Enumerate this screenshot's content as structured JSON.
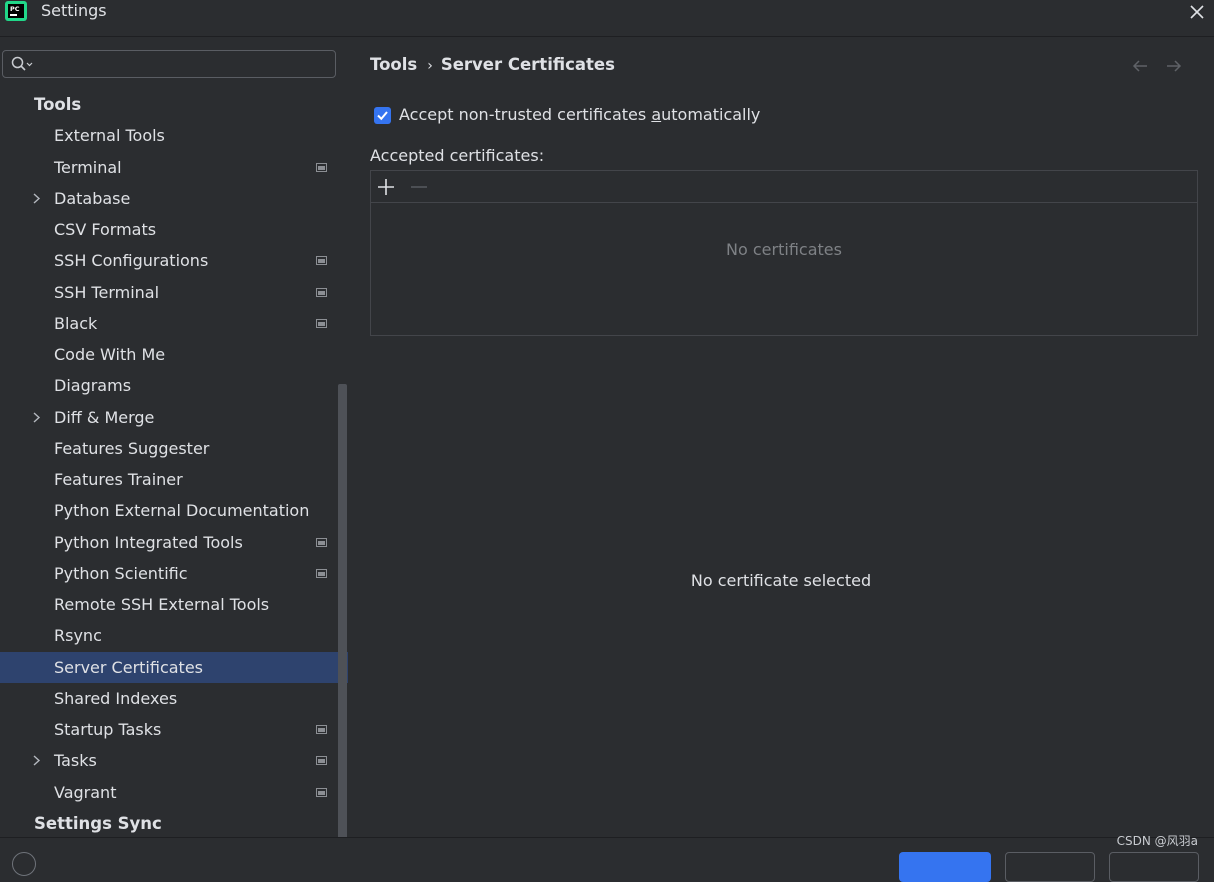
{
  "window": {
    "title": "Settings"
  },
  "search": {
    "placeholder": "",
    "value": ""
  },
  "sidebar": {
    "rows": [
      {
        "label": "Tools",
        "group": true
      },
      {
        "label": "External Tools"
      },
      {
        "label": "Terminal",
        "project": true
      },
      {
        "label": "Database",
        "expandable": true
      },
      {
        "label": "CSV Formats"
      },
      {
        "label": "SSH Configurations",
        "project": true
      },
      {
        "label": "SSH Terminal",
        "project": true
      },
      {
        "label": "Black",
        "project": true
      },
      {
        "label": "Code With Me"
      },
      {
        "label": "Diagrams"
      },
      {
        "label": "Diff & Merge",
        "expandable": true
      },
      {
        "label": "Features Suggester"
      },
      {
        "label": "Features Trainer"
      },
      {
        "label": "Python External Documentation"
      },
      {
        "label": "Python Integrated Tools",
        "project": true
      },
      {
        "label": "Python Scientific",
        "project": true
      },
      {
        "label": "Remote SSH External Tools"
      },
      {
        "label": "Rsync"
      },
      {
        "label": "Server Certificates",
        "selected": true
      },
      {
        "label": "Shared Indexes"
      },
      {
        "label": "Startup Tasks",
        "project": true
      },
      {
        "label": "Tasks",
        "expandable": true,
        "project": true
      },
      {
        "label": "Vagrant",
        "project": true
      },
      {
        "label": "Settings Sync",
        "group": true
      }
    ]
  },
  "breadcrumb": {
    "parent": "Tools",
    "separator": "›",
    "current": "Server Certificates"
  },
  "options": {
    "accept_checkbox": {
      "checked": true,
      "label_before": "Accept non-trusted certificates ",
      "label_mnemonic": "a",
      "label_after": "utomatically"
    }
  },
  "certificates": {
    "label": "Accepted certificates:",
    "empty_text": "No certificates",
    "detail_empty": "No certificate selected"
  },
  "watermark": "CSDN @风羽a",
  "colors": {
    "accent": "#3574f0",
    "selection": "#2e436e",
    "background": "#2b2d30"
  }
}
